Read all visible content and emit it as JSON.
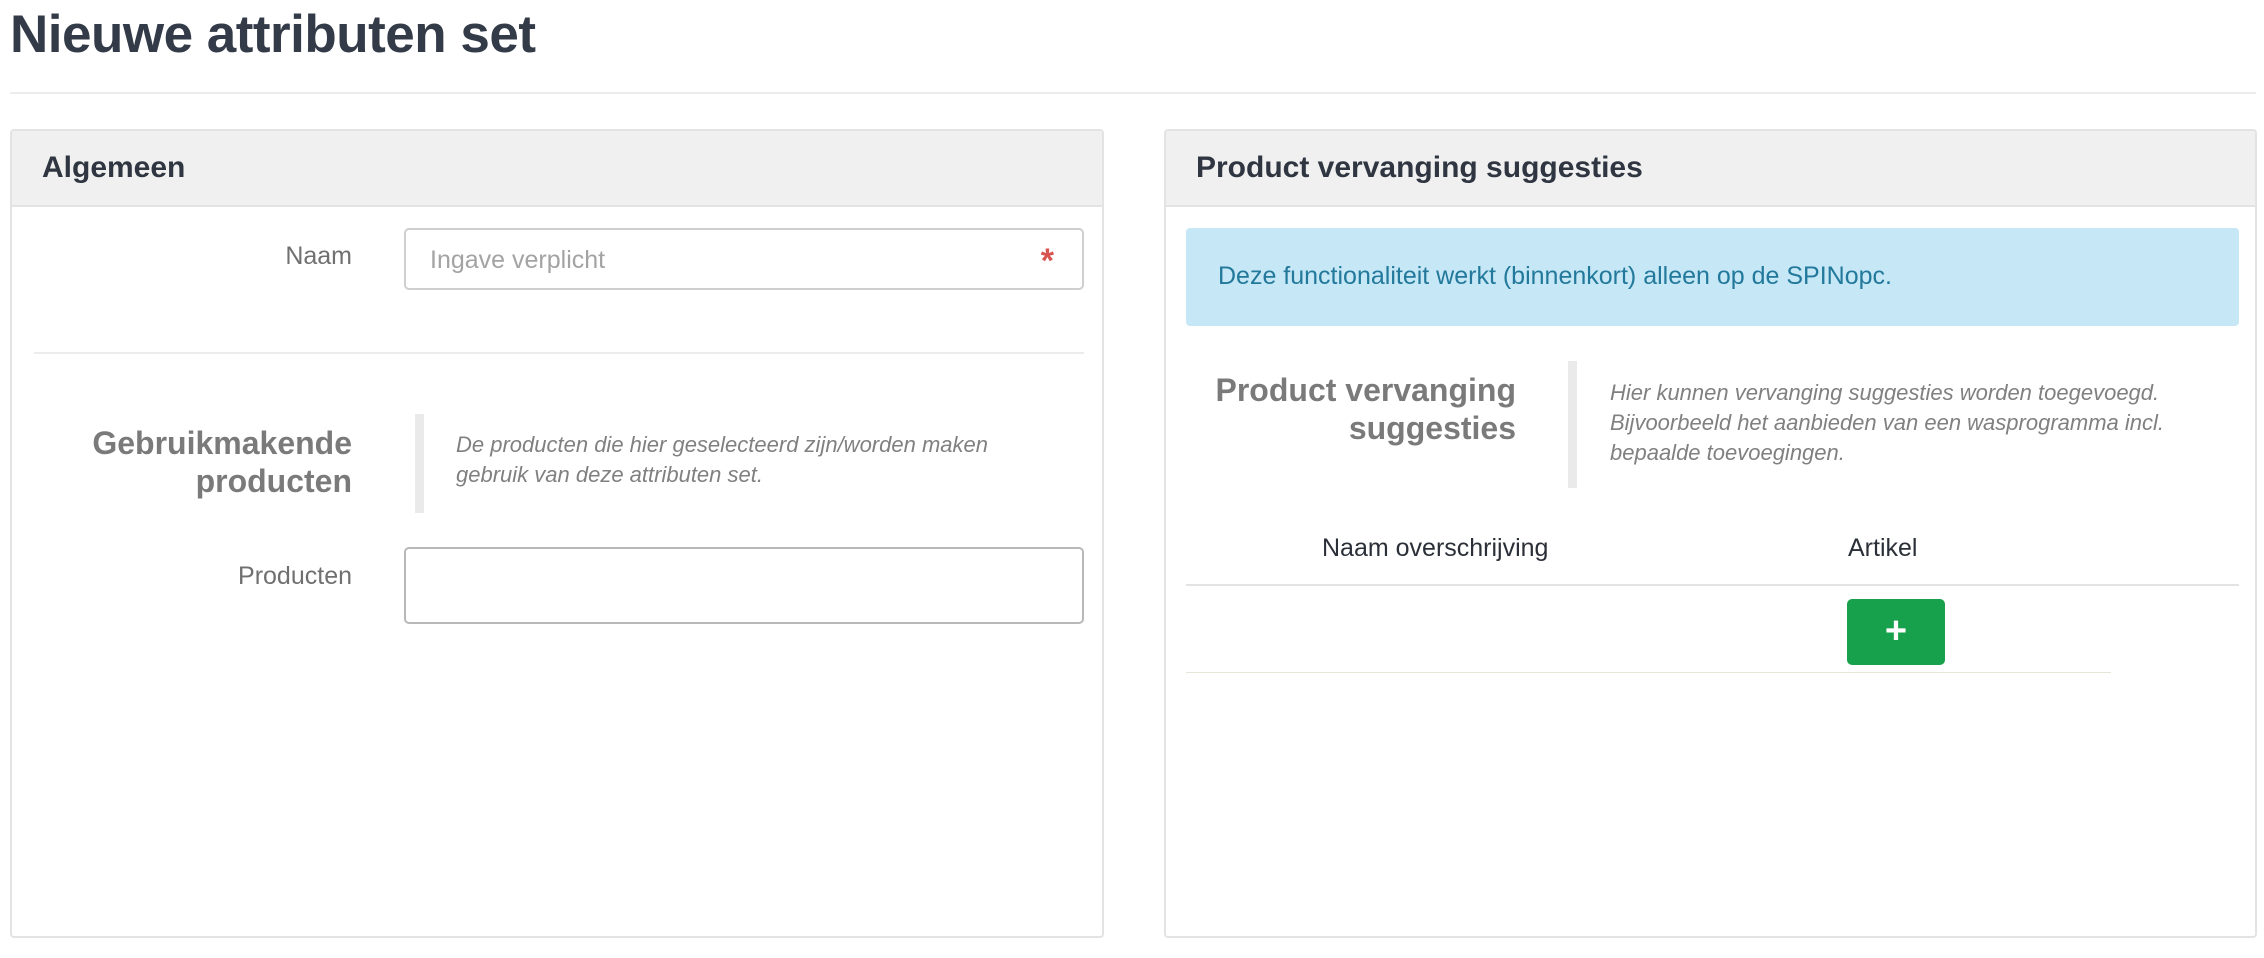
{
  "page": {
    "title": "Nieuwe attributen set"
  },
  "general_panel": {
    "heading": "Algemeen",
    "name_field": {
      "label": "Naam",
      "placeholder": "Ingave verplicht",
      "value": "",
      "required_marker": "*"
    },
    "using_products": {
      "title": "Gebruikmakende producten",
      "description": "De producten die hier geselecteerd zijn/worden maken gebruik van deze attributen set."
    },
    "products_field": {
      "label": "Producten",
      "value": ""
    }
  },
  "replacement_panel": {
    "heading": "Product vervanging suggesties",
    "alert": "Deze functionaliteit werkt (binnenkort) alleen op de SPINopc.",
    "section": {
      "title": "Product vervanging suggesties",
      "description": "Hier kunnen vervanging suggesties worden toegevoegd. Bijvoorbeeld het aanbieden van een wasprogramma incl. bepaalde toevoegingen."
    },
    "table": {
      "columns": [
        "Naam overschrijving",
        "Artikel"
      ],
      "add_button": "+"
    }
  },
  "colors": {
    "title": "#343b48",
    "panel_header_bg": "#f0f0f0",
    "alert_bg": "#c6e7f5",
    "alert_text": "#22799b",
    "add_button": "#18a14c",
    "required": "#d9534f"
  }
}
